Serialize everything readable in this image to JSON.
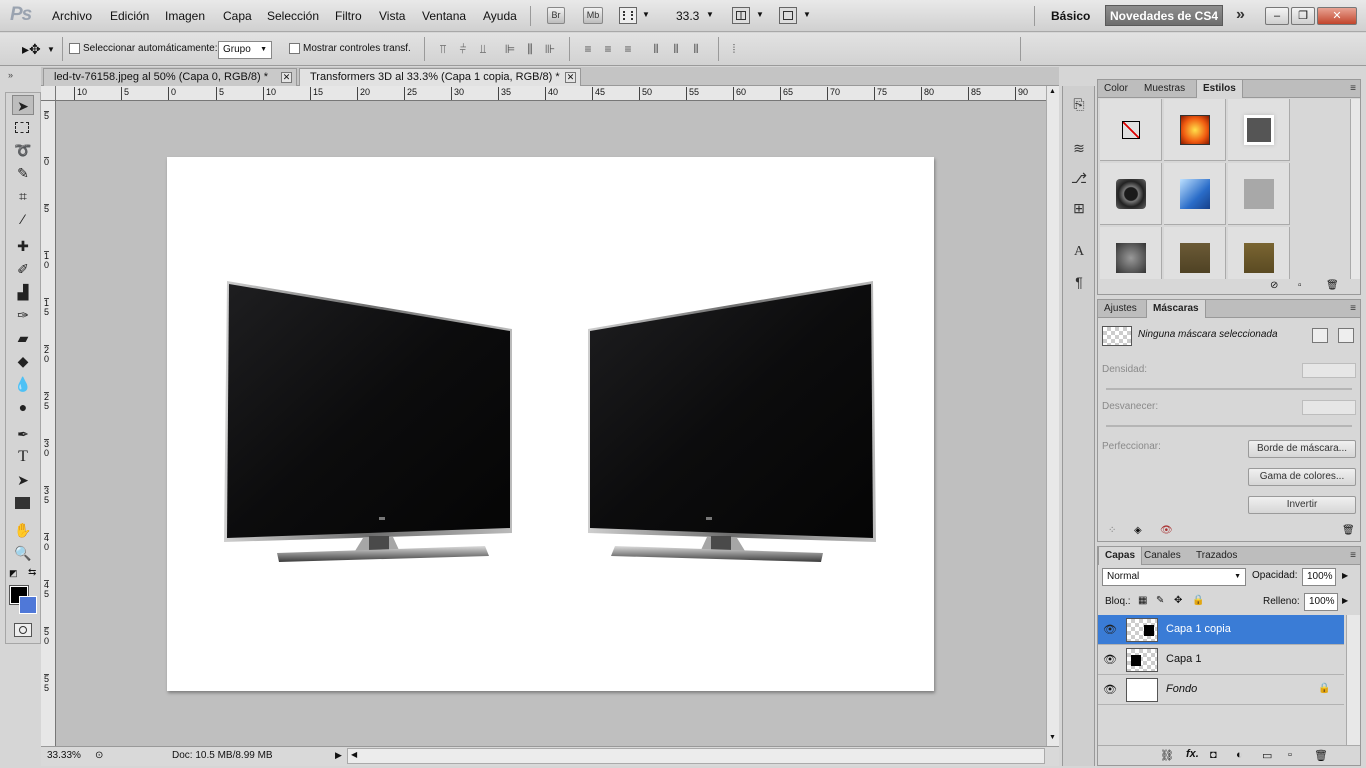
{
  "app": {
    "logo": "Ps"
  },
  "menu": [
    "Archivo",
    "Edición",
    "Imagen",
    "Capa",
    "Selección",
    "Filtro",
    "Vista",
    "Ventana",
    "Ayuda"
  ],
  "appbar": {
    "bridge": "Br",
    "minibridge": "Mb",
    "zoom": "33.3",
    "workspace": "Básico",
    "workspace_cs4": "Novedades de CS4",
    "overflow": "»"
  },
  "options": {
    "auto_select_label": "Seleccionar automáticamente:",
    "auto_select_value": "Grupo",
    "transform_label": "Mostrar controles transf."
  },
  "tabs": [
    {
      "label": "led-tv-76158.jpeg al 50% (Capa 0, RGB/8) *",
      "active": false
    },
    {
      "label": "Transformers 3D al 33.3% (Capa 1 copia, RGB/8) *",
      "active": true
    }
  ],
  "ruler_top": [
    "10",
    "5",
    "0",
    "5",
    "10",
    "15",
    "20",
    "25",
    "30",
    "35",
    "40",
    "45",
    "50",
    "55",
    "60",
    "65",
    "70",
    "75",
    "80",
    "85",
    "90"
  ],
  "ruler_left": [
    "5",
    "0",
    "5",
    "1\n0",
    "1\n5",
    "2\n0",
    "2\n5",
    "3\n0",
    "3\n5",
    "4\n0",
    "4\n5",
    "5\n0",
    "5\n5"
  ],
  "status": {
    "zoom": "33.33%",
    "doc": "Doc: 10.5 MB/8.99 MB"
  },
  "styles_panel": {
    "tabs": [
      "Color",
      "Muestras",
      "Estilos"
    ],
    "active": "Estilos"
  },
  "masks_panel": {
    "tabs": [
      "Ajustes",
      "Máscaras"
    ],
    "active": "Máscaras",
    "status": "Ninguna máscara seleccionada",
    "density_label": "Densidad:",
    "feather_label": "Desvanecer:",
    "refine_label": "Perfeccionar:",
    "buttons": [
      "Borde de máscara...",
      "Gama de colores...",
      "Invertir"
    ]
  },
  "layers_panel": {
    "tabs": [
      "Capas",
      "Canales",
      "Trazados"
    ],
    "active": "Capas",
    "blend_mode": "Normal",
    "opacity_label": "Opacidad:",
    "opacity": "100%",
    "lock_label": "Bloq.:",
    "fill_label": "Relleno:",
    "fill": "100%",
    "layers": [
      {
        "name": "Capa 1 copia",
        "selected": true
      },
      {
        "name": "Capa 1",
        "selected": false
      },
      {
        "name": "Fondo",
        "selected": false
      }
    ]
  },
  "colors": {
    "foreground": "#000000",
    "background": "#4f78d8",
    "selection": "#3a7cd6"
  }
}
